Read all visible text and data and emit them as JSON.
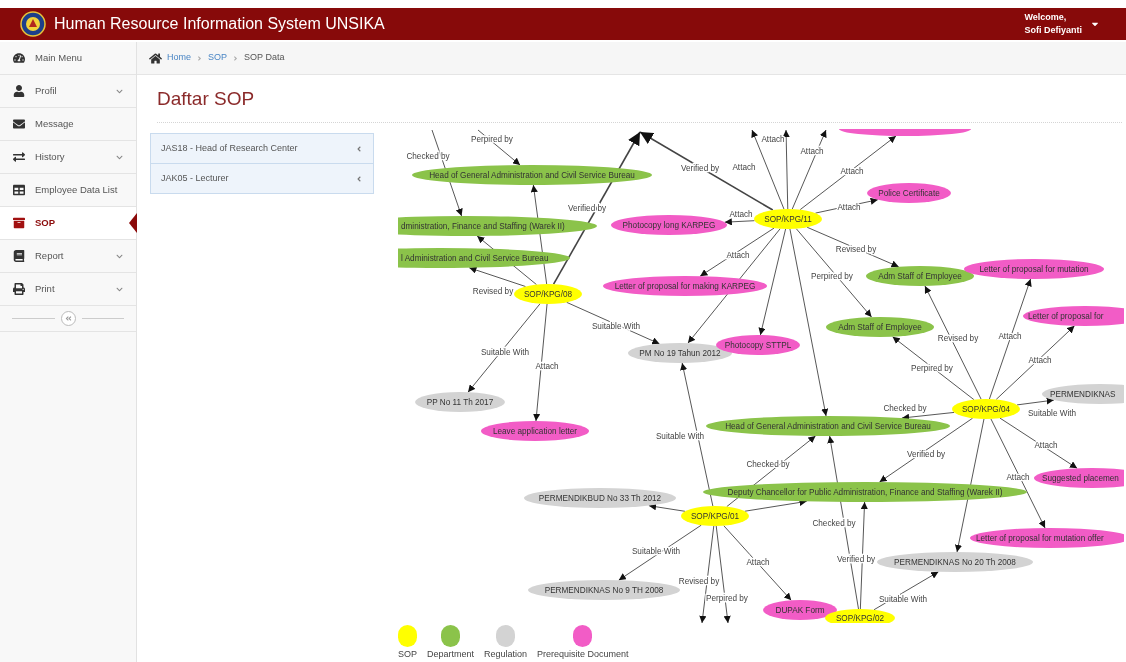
{
  "header": {
    "title": "Human Resource Information System UNSIKA",
    "welcome": "Welcome,",
    "user": "Sofi Defiyanti"
  },
  "sidebar": {
    "items": [
      {
        "label": "Main Menu",
        "expandable": false,
        "selected": false
      },
      {
        "label": "Profil",
        "expandable": true,
        "selected": false
      },
      {
        "label": "Message",
        "expandable": false,
        "selected": false
      },
      {
        "label": "History",
        "expandable": true,
        "selected": false
      },
      {
        "label": "Employee Data List",
        "expandable": false,
        "selected": false
      },
      {
        "label": "SOP",
        "expandable": false,
        "selected": true
      },
      {
        "label": "Report",
        "expandable": true,
        "selected": false
      },
      {
        "label": "Print",
        "expandable": true,
        "selected": false
      }
    ]
  },
  "breadcrumb": [
    {
      "label": "Home",
      "current": false
    },
    {
      "label": "SOP",
      "current": false
    },
    {
      "label": "SOP Data",
      "current": true
    }
  ],
  "page_title": "Daftar SOP",
  "positions": [
    {
      "label": "JAS18 - Head of Research Center",
      "expanded": false
    },
    {
      "label": "JAK05 - Lecturer",
      "expanded": false
    }
  ],
  "graph": {
    "nodes": [
      {
        "label": "Head of General Administration and Civil Service Bureau",
        "kind": "department"
      },
      {
        "label": "dministration, Finance and Staffing (Warek II)",
        "kind": "department"
      },
      {
        "label": "l Administration and Civil Service Bureau",
        "kind": "department"
      },
      {
        "label": "SOP/KPG/08",
        "kind": "sop"
      },
      {
        "label": "PP No 11 Th 2017",
        "kind": "regulation"
      },
      {
        "label": "Leave application letter",
        "kind": "document"
      },
      {
        "label": "Photocopy long KARPEG",
        "kind": "document"
      },
      {
        "label": "SOP/KPG/11",
        "kind": "sop"
      },
      {
        "label": "Police Certificate",
        "kind": "document"
      },
      {
        "kind": "document"
      },
      {
        "label": "Letter of proposal for making KARPEG",
        "kind": "document"
      },
      {
        "label": "PM No 19 Tahun 2012",
        "kind": "regulation"
      },
      {
        "label": "Photocopy STTPL",
        "kind": "document"
      },
      {
        "label": "Adm Staff of Employee",
        "kind": "department"
      },
      {
        "label": "Letter of proposal for mutation",
        "kind": "document"
      },
      {
        "label": "Adm Staff of Employee",
        "kind": "department"
      },
      {
        "label": "Letter of proposal for",
        "kind": "document"
      },
      {
        "label": "PERMENDIKNAS",
        "kind": "regulation"
      },
      {
        "label": "SOP/KPG/04",
        "kind": "sop"
      },
      {
        "label": "Head of General Administration and Civil Service Bureau",
        "kind": "department"
      },
      {
        "label": "Suggested placemen",
        "kind": "document"
      },
      {
        "label": "Deputy Chancellor for Public Administration, Finance and Staffing (Warek II)",
        "kind": "department"
      },
      {
        "label": "PERMENDIKBUD No 33 Th 2012",
        "kind": "regulation"
      },
      {
        "label": "SOP/KPG/01",
        "kind": "sop"
      },
      {
        "label": "Letter of proposal for mutation offer",
        "kind": "document"
      },
      {
        "label": "PERMENDIKNAS No 20 Th 2008",
        "kind": "regulation"
      },
      {
        "label": "PERMENDIKNAS No 9 TH 2008",
        "kind": "regulation"
      },
      {
        "label": "DUPAK Form",
        "kind": "document"
      },
      {
        "label": "SOP/KPG/02",
        "kind": "sop"
      }
    ],
    "edges": [
      {
        "label": "Revised by"
      },
      {
        "label": "Verified by"
      },
      {
        "label": "Suitable With"
      },
      {
        "label": "Suitable With"
      },
      {
        "label": "Attach"
      },
      {
        "label": "Checked by"
      },
      {
        "label": "Perpired by"
      },
      {
        "label": "Verified by"
      },
      {
        "label": "Attach"
      },
      {
        "label": "Attach"
      },
      {
        "label": "Attach"
      },
      {
        "label": "Attach"
      },
      {
        "label": "Attach"
      },
      {
        "label": "Attach"
      },
      {
        "label": "Attach"
      },
      {
        "label": "Revised by"
      },
      {
        "label": "Perpired by"
      },
      {
        "label": "Revised by"
      },
      {
        "label": "Attach"
      },
      {
        "label": "Attach"
      },
      {
        "label": "Perpired by"
      },
      {
        "label": "Suitable With"
      },
      {
        "label": "Checked by"
      },
      {
        "label": "Verified by"
      },
      {
        "label": "Attach"
      },
      {
        "label": "Attach"
      },
      {
        "label": "Suitable With"
      },
      {
        "label": "Checked by"
      },
      {
        "label": "Suitable With"
      },
      {
        "label": "Attach"
      },
      {
        "label": "Revised by"
      },
      {
        "label": "Perpired by"
      },
      {
        "label": "Checked by"
      },
      {
        "label": "Verified by"
      },
      {
        "label": "Suitable With"
      }
    ],
    "legend": [
      {
        "label": "SOP",
        "kind": "sop",
        "color": "#ffff00"
      },
      {
        "label": "Department",
        "kind": "department",
        "color": "#8bc34a"
      },
      {
        "label": "Regulation",
        "kind": "regulation",
        "color": "#d3d3d3"
      },
      {
        "label": "Prerequisite Document",
        "kind": "document",
        "color": "#f25cc6"
      }
    ]
  }
}
